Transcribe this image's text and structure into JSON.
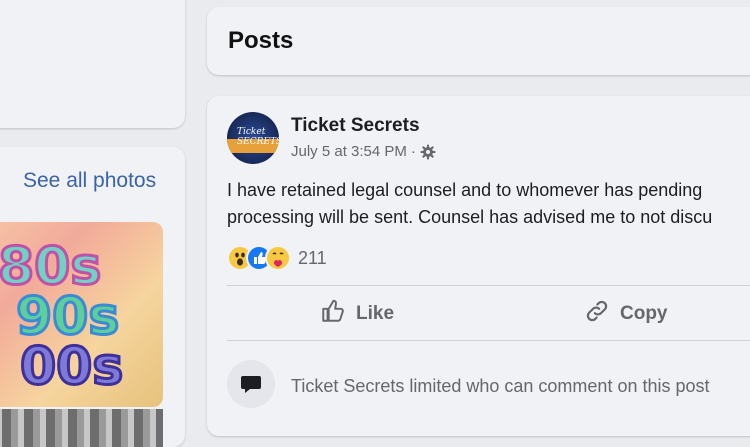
{
  "sidebar": {
    "see_all_photos": "See all photos",
    "photo_text": [
      "80s",
      "90s",
      "00s"
    ]
  },
  "posts_header": {
    "title": "Posts"
  },
  "post": {
    "page_name": "Ticket Secrets",
    "avatar_text": "Ticket SECRETS",
    "timestamp": "July 5 at 3:54 PM",
    "separator": "·",
    "text_line1": "I have retained legal counsel and to whomever has pending",
    "text_line2": "processing will be sent. Counsel has advised me to not discu",
    "reaction_icons": [
      "wow-icon",
      "like-icon",
      "care-icon"
    ],
    "reaction_count": "211",
    "actions": {
      "like": "Like",
      "copy": "Copy"
    },
    "comment_notice": "Ticket Secrets limited who can comment on this post"
  },
  "colors": {
    "background": "#e9ebee",
    "card": "#f0f2f5",
    "link_blue": "#3a63a8",
    "secondary_text": "#65676b"
  }
}
